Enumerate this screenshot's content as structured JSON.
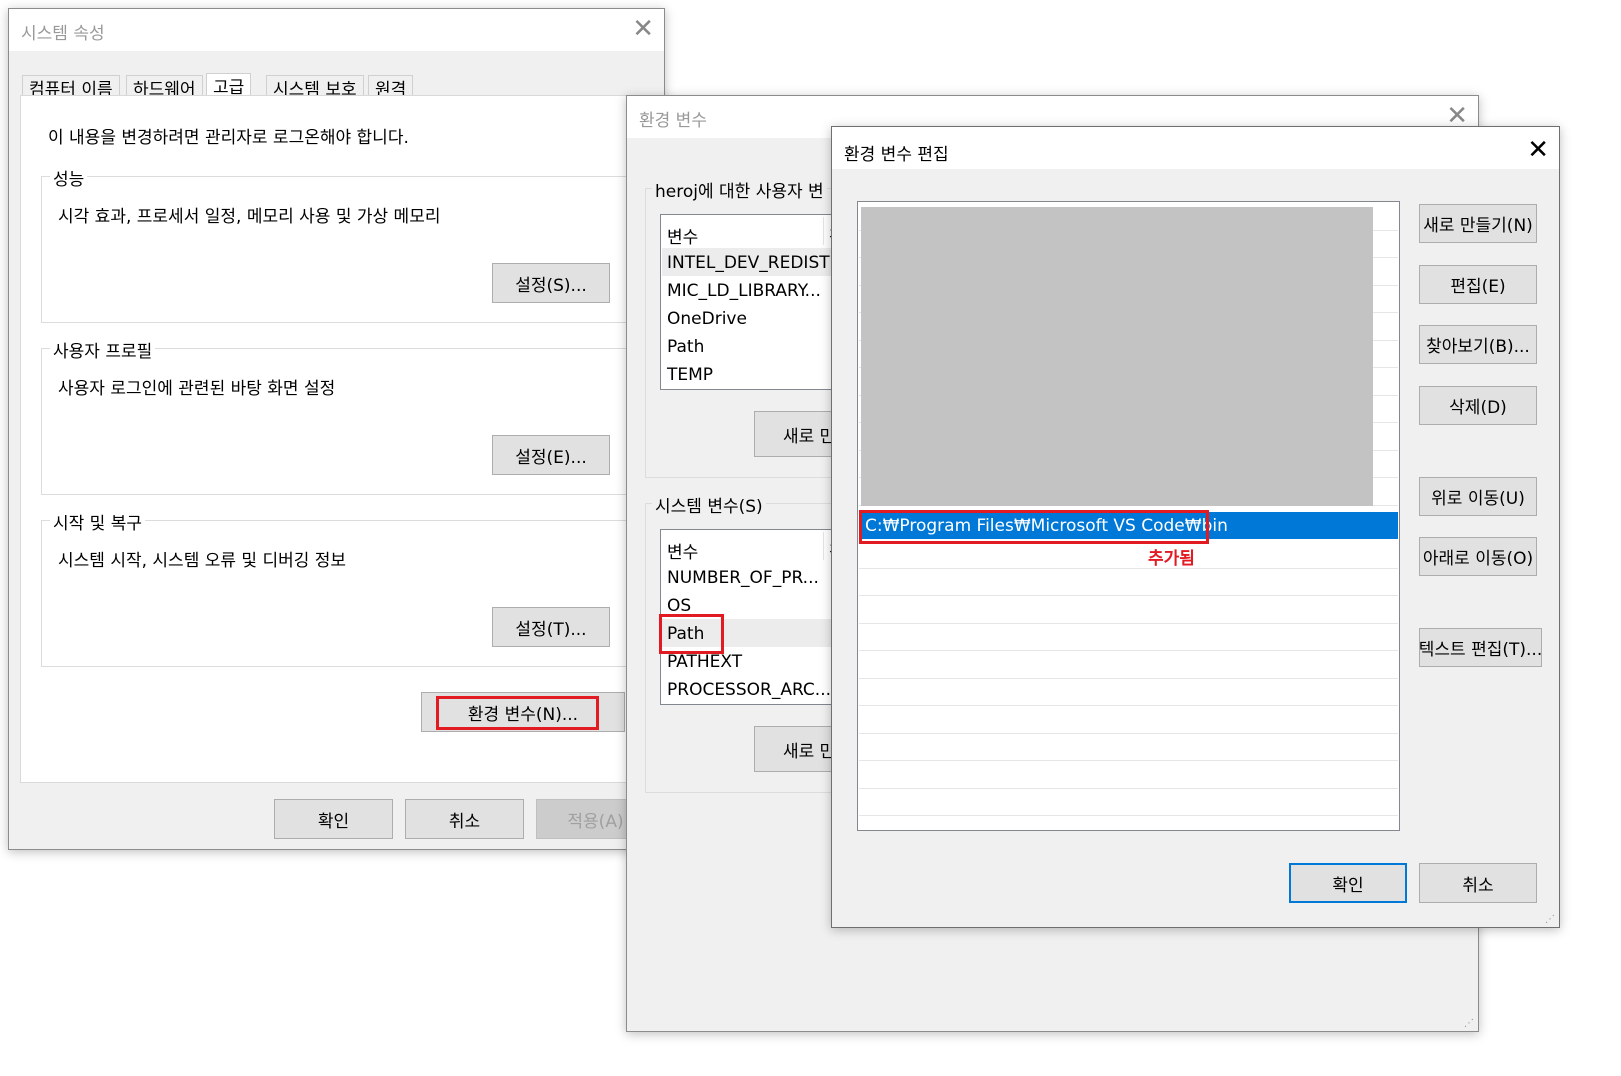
{
  "sysprops": {
    "title": "시스템 속성",
    "tabs": [
      "컴퓨터 이름",
      "하드웨어",
      "고급",
      "시스템 보호",
      "원격"
    ],
    "admin_note": "이 내용을 변경하려면 관리자로 로그온해야 합니다.",
    "performance": {
      "label": "성능",
      "desc": "시각 효과, 프로세서 일정, 메모리 사용 및 가상 메모리",
      "button": "설정(S)..."
    },
    "profile": {
      "label": "사용자 프로필",
      "desc": "사용자 로그인에 관련된 바탕 화면 설정",
      "button": "설정(E)..."
    },
    "startup": {
      "label": "시작 및 복구",
      "desc": "시스템 시작, 시스템 오류 및 디버깅 정보",
      "button": "설정(T)..."
    },
    "env_button": "환경 변수(N)...",
    "ok": "확인",
    "cancel": "취소",
    "apply": "적용(A)"
  },
  "envvars": {
    "title": "환경 변수",
    "user_label": "heroj에 대한 사용자 변",
    "user_header": "변수",
    "user_header2": "값",
    "user_rows": [
      "INTEL_DEV_REDIST",
      "MIC_LD_LIBRARY...",
      "OneDrive",
      "Path",
      "TEMP"
    ],
    "user_new": "새로 만",
    "system_label": "시스템 변수(S)",
    "system_header": "변수",
    "system_header2": "값",
    "system_rows": [
      "NUMBER_OF_PR...",
      "OS",
      "Path",
      "PATHEXT",
      "PROCESSOR_ARC..."
    ],
    "system_new": "새로 만"
  },
  "editdlg": {
    "title": "환경 변수 편집",
    "selected_entry": "C:₩Program Files₩Microsoft VS Code₩bin",
    "annotation": "추가됨",
    "buttons": {
      "new": "새로 만들기(N)",
      "edit": "편집(E)",
      "browse": "찾아보기(B)...",
      "delete": "삭제(D)",
      "up": "위로 이동(U)",
      "down": "아래로 이동(O)",
      "text_edit": "텍스트 편집(T)...",
      "ok": "확인",
      "cancel": "취소"
    }
  },
  "colors": {
    "selection": "#0078d7",
    "highlight_box": "#e21b23",
    "redacted": "#c3c3c3"
  }
}
